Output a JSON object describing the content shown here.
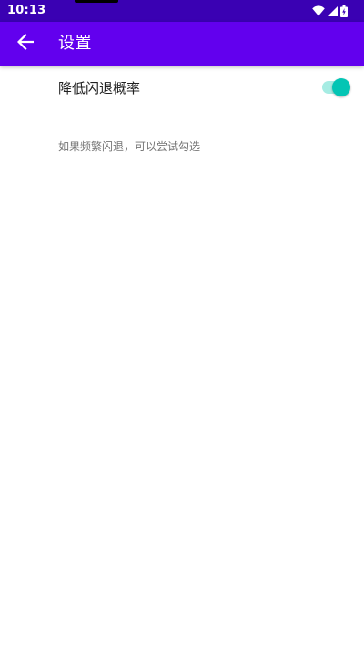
{
  "status_bar": {
    "time": "10:13",
    "icons": [
      "wifi-icon",
      "cell-signal-icon",
      "battery-charging-icon"
    ]
  },
  "app_bar": {
    "back_icon": "arrow-back-icon",
    "title": "设置"
  },
  "settings": {
    "reduce_crash": {
      "title": "降低闪退概率",
      "summary": "如果频繁闪退，可以尝试勾选",
      "switch_on": true
    }
  },
  "colors": {
    "status_bar": "#3a01b3",
    "app_bar": "#6200ee",
    "switch_thumb": "#03c5b4",
    "switch_track": "#a6ece3"
  }
}
